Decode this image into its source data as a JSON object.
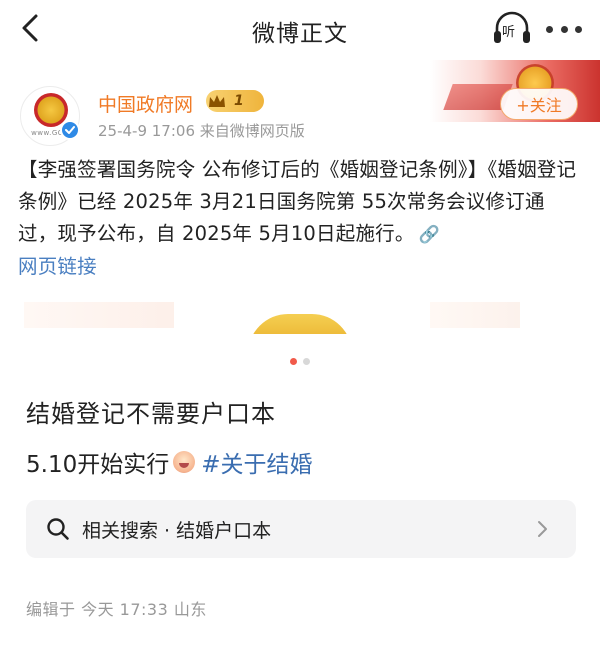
{
  "nav": {
    "title": "微博正文",
    "listen_label": "听"
  },
  "post": {
    "author": {
      "name": "中国政府网",
      "avatar_caption": "www.GOV",
      "member_level": "1"
    },
    "meta": "25-4-9 17:06  来自微博网页版",
    "follow_label": "+关注",
    "text_main": "【李强签署国务院令 公布修订后的《婚姻登记条例》】《婚姻登记条例》已经 2025年 3月21日国务院第 55次常务会议修订通过，现予公布，自 2025年 5月10日起施行。",
    "link_label": "网页链接",
    "carousel": {
      "count": 2,
      "active_index": 0
    }
  },
  "article": {
    "title": "结婚登记不需要户口本",
    "subtitle_prefix": "5.10开始实行",
    "hashtag": "#关于结婚",
    "related_search": "相关搜索 · 结婚户口本",
    "edit_meta": "编辑于  今天 17:33  山东"
  },
  "colors": {
    "author_name": "#f07a26",
    "link": "#4a7fc1",
    "hashtag": "#3a6db0",
    "active_dot": "#f15a4a",
    "verified": "#2f8ae6"
  }
}
